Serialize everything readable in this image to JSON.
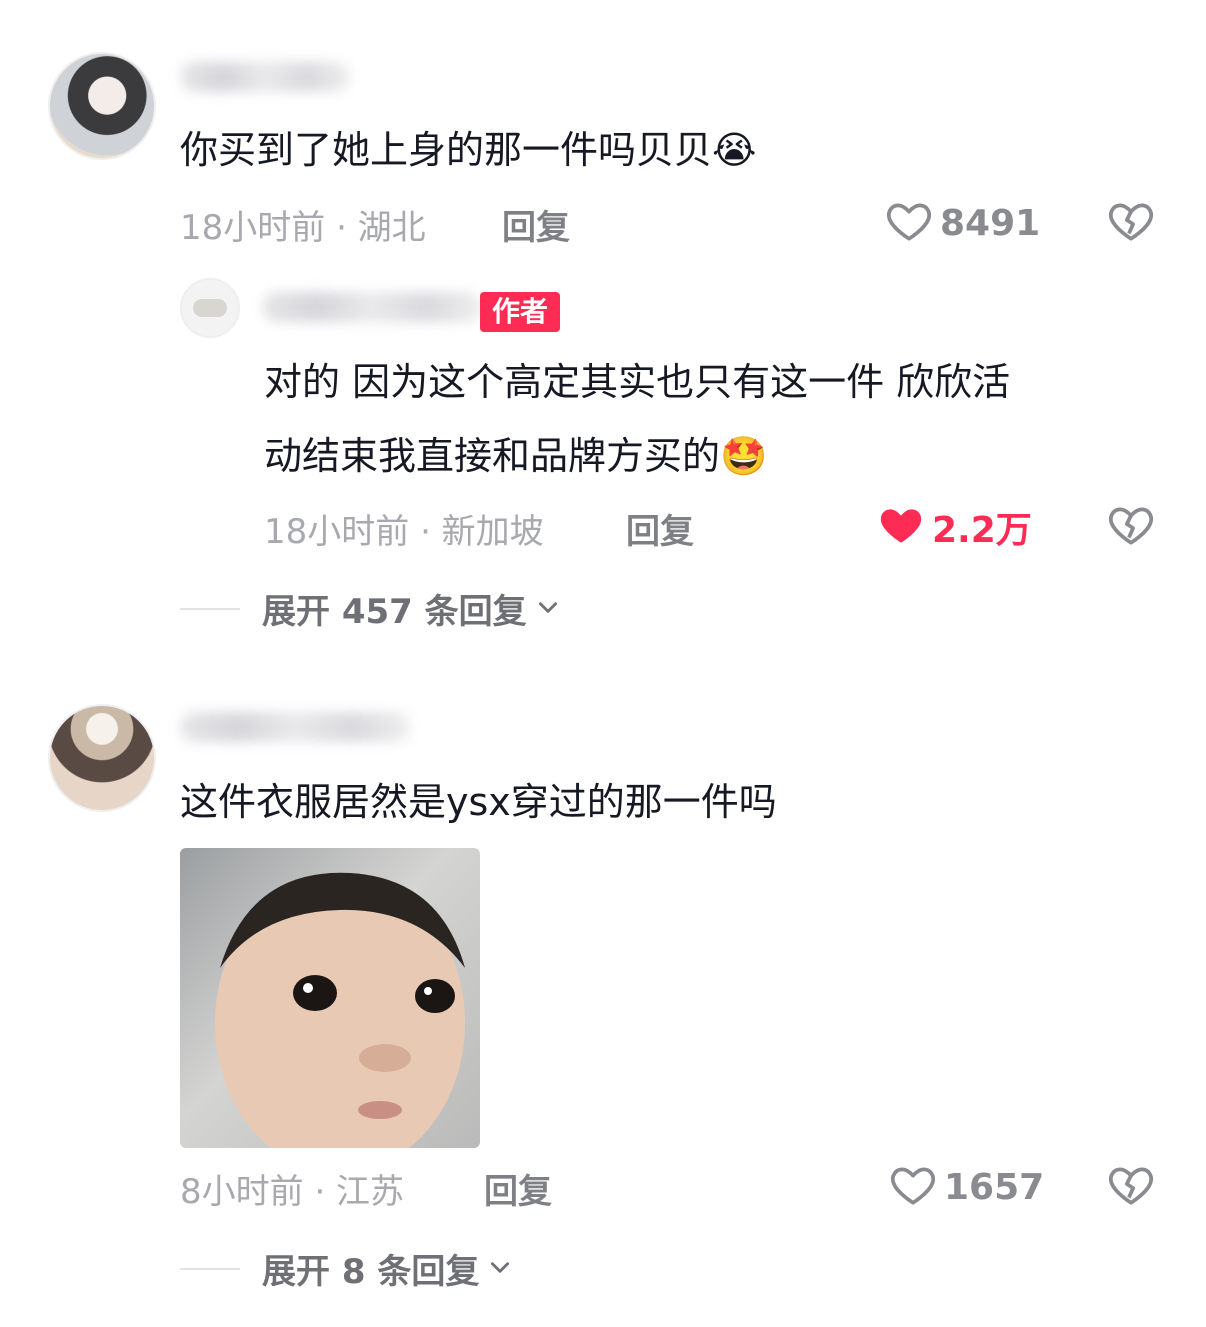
{
  "comments": [
    {
      "text": "你买到了她上身的那一件吗贝贝",
      "emoji": "😭",
      "meta": "18小时前 · 湖北",
      "reply_label": "回复",
      "likes": "8491",
      "replies": [
        {
          "badge": "作者",
          "text_line1": "对的 因为这个高定其实也只有这一件 欣欣活",
          "text_line2": "动结束我直接和品牌方买的",
          "emoji": "🤩",
          "meta": "18小时前 · 新加坡",
          "reply_label": "回复",
          "likes": "2.2万",
          "liked": true
        }
      ],
      "expand_label": "展开 457 条回复"
    },
    {
      "text": "这件衣服居然是ysx穿过的那一件吗",
      "meta": "8小时前 · 江苏",
      "reply_label": "回复",
      "likes": "1657",
      "expand_label": "展开 8 条回复"
    }
  ],
  "colors": {
    "accent": "#fe2c55",
    "meta": "#a8a9ae",
    "text": "#161823"
  },
  "icons": [
    "heart-outline-icon",
    "heart-filled-icon",
    "broken-heart-icon",
    "chevron-down-icon"
  ]
}
